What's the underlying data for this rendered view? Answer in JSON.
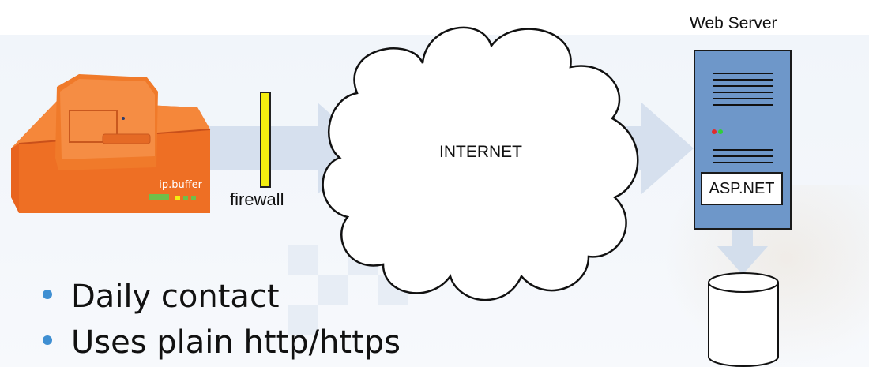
{
  "labels": {
    "server_title": "Web Server",
    "internet": "INTERNET",
    "firewall": "firewall",
    "asp": "ASP.NET"
  },
  "device": {
    "brand_text": "ip.buffer",
    "colors": {
      "body": "#f07a2a",
      "top": "#f58a3a"
    }
  },
  "bullets": [
    {
      "text": "Daily contact"
    },
    {
      "text": "Uses plain http/https"
    }
  ],
  "colors": {
    "arrow": "#d3deec",
    "server": "#6e97c9",
    "firewall": "#f4ee10",
    "bullet": "#3f8fd2"
  }
}
